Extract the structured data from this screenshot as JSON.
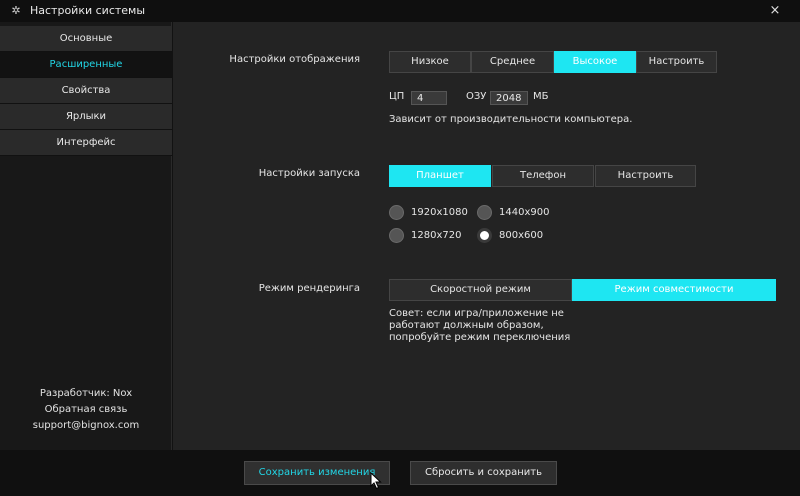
{
  "window": {
    "title": "Настройки системы",
    "close_label": "×",
    "icon": "gear-icon"
  },
  "sidebar": {
    "items": [
      {
        "label": "Основные",
        "active": false
      },
      {
        "label": "Расширенные",
        "active": true
      },
      {
        "label": "Свойства",
        "active": false
      },
      {
        "label": "Ярлыки",
        "active": false
      },
      {
        "label": "Интерфейс",
        "active": false
      }
    ],
    "developer": "Разработчик: Nox",
    "feedback": "Обратная связь",
    "email": "support@bignox.com"
  },
  "display": {
    "label": "Настройки отображения",
    "options": [
      "Низкое",
      "Среднее",
      "Высокое",
      "Настроить"
    ],
    "selected": "Высокое",
    "cpu_label": "ЦП",
    "cpu_value": "4",
    "ram_label": "ОЗУ",
    "ram_value": "2048",
    "ram_unit": "МБ",
    "note": "Зависит от производительности компьютера."
  },
  "startup": {
    "label": "Настройки запуска",
    "options": [
      "Планшет",
      "Телефон",
      "Настроить"
    ],
    "selected": "Планшет",
    "resolutions": [
      {
        "label": "1920x1080",
        "checked": false
      },
      {
        "label": "1440x900",
        "checked": false
      },
      {
        "label": "1280x720",
        "checked": false
      },
      {
        "label": "800x600",
        "checked": true
      }
    ]
  },
  "render": {
    "label": "Режим рендеринга",
    "options": [
      "Скоростной режим",
      "Режим совместимости"
    ],
    "selected": "Режим совместимости",
    "tip": "Совет: если игра/приложение не работают должным образом, попробуйте режим переключения"
  },
  "footer": {
    "save_label": "Сохранить изменения",
    "reset_label": "Сбросить и сохранить"
  },
  "colors": {
    "accent": "#1ee6f2",
    "accent_text": "#22d6e6"
  }
}
